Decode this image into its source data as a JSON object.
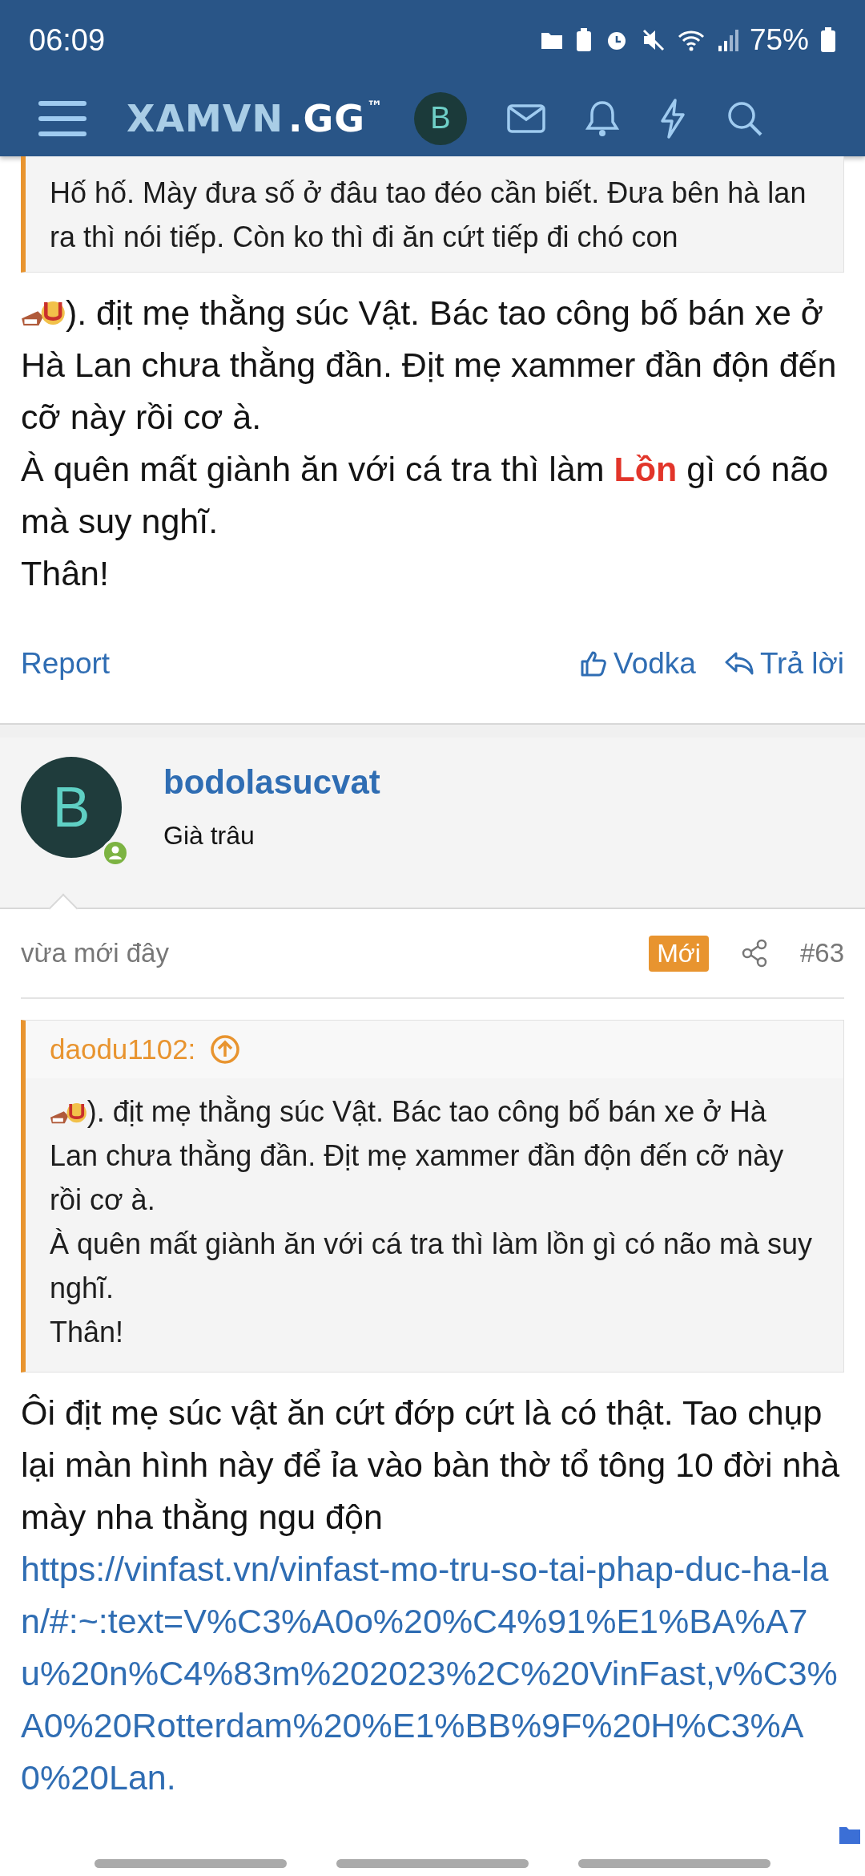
{
  "status_bar": {
    "time": "06:09",
    "battery": "75%"
  },
  "nav": {
    "logo_main": "XAMVN",
    "logo_suffix": ".GG",
    "logo_mark": "™",
    "avatar_letter": "B"
  },
  "top_quote": {
    "text": "Hố hố. Mày đưa số ở đâu tao đéo cần biết. Đưa bên hà lan ra thì nói tiếp. Còn ko thì đi ăn cứt tiếp đi chó con"
  },
  "top_post": {
    "paragraphs": [
      [
        {
          "kind": "emoji"
        },
        {
          "kind": "plain",
          "text": "). địt mẹ thằng súc Vật. Bác tao công bố bán xe ở Hà Lan chưa thằng đần. Địt mẹ xammer đần độn đến cỡ này rồi cơ à."
        }
      ],
      [
        {
          "kind": "plain",
          "text": "À quên mất giành ăn với cá tra thì làm "
        },
        {
          "kind": "highlight",
          "text": "Lồn"
        },
        {
          "kind": "plain",
          "text": " gì có não mà suy nghĩ."
        }
      ],
      [
        {
          "kind": "plain",
          "text": "Thân!"
        }
      ]
    ],
    "actions": {
      "report": "Report",
      "like": "Vodka",
      "reply": "Trả lời"
    }
  },
  "post": {
    "avatar_letter": "B",
    "online": true,
    "username": "bodolasucvat",
    "user_title": "Già trâu",
    "time": "vừa mới đây",
    "badge": "Mới",
    "number": "#63",
    "quote": {
      "author": "daodu1102:",
      "paragraphs": [
        [
          {
            "kind": "emoji"
          },
          {
            "kind": "plain",
            "text": "). địt mẹ thằng súc Vật. Bác tao công bố bán xe ở Hà Lan chưa thằng đần. Địt mẹ xammer đần độn đến cỡ này rồi cơ à."
          }
        ],
        [
          {
            "kind": "plain",
            "text": "À quên mất giành ăn với cá tra thì làm lồn gì có não mà suy nghĩ."
          }
        ],
        [
          {
            "kind": "plain",
            "text": "Thân!"
          }
        ]
      ]
    },
    "body": "Ôi địt mẹ súc vật ăn cứt đớp cứt là có thật. Tao chụp lại màn hình này để ỉa vào bàn thờ tổ tông 10 đời nhà mày nha thằng ngu độn",
    "link": "https://vinfast.vn/vinfast-mo-tru-so-tai-phap-duc-ha-lan/#:~:text=V%C3%A0o%20%C4%91%E1%BA%A7u%20n%C4%83m%202023%2C%20VinFast,v%C3%A0%20Rotterdam%20%E1%BB%9F%20H%C3%A0%20Lan."
  }
}
